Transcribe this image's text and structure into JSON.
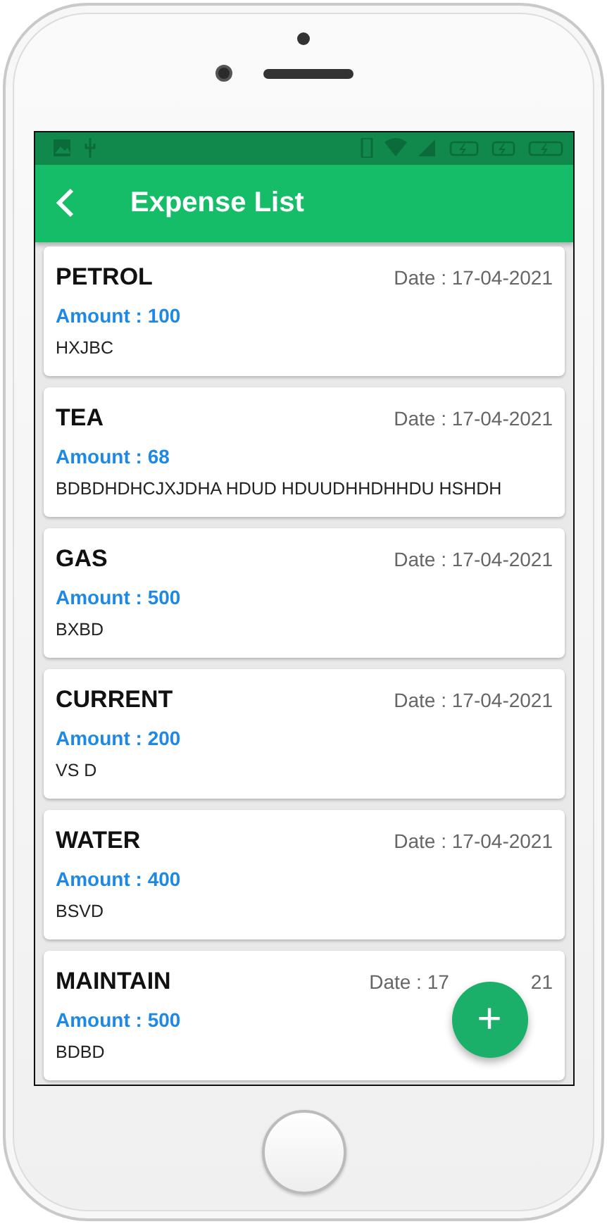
{
  "app_bar": {
    "title": "Expense List"
  },
  "expenses": [
    {
      "name": "PETROL",
      "date": "Date : 17-04-2021",
      "amount": "Amount : 100",
      "note": "HXJBC"
    },
    {
      "name": "TEA",
      "date": "Date : 17-04-2021",
      "amount": "Amount : 68",
      "note": "BDBDHDHCJXJDHA HDUD HDUUDHHDHHDU HSHDH"
    },
    {
      "name": "GAS",
      "date": "Date : 17-04-2021",
      "amount": "Amount : 500",
      "note": "BXBD"
    },
    {
      "name": "CURRENT",
      "date": "Date : 17-04-2021",
      "amount": "Amount : 200",
      "note": "VS D"
    },
    {
      "name": "WATER",
      "date": "Date : 17-04-2021",
      "amount": "Amount : 400",
      "note": "BSVD"
    },
    {
      "name": "MAINTAIN",
      "date": "Date : 17",
      "date_tail": "21",
      "amount": "Amount : 500",
      "note": "BDBD"
    }
  ],
  "fab": {
    "label": "+"
  }
}
